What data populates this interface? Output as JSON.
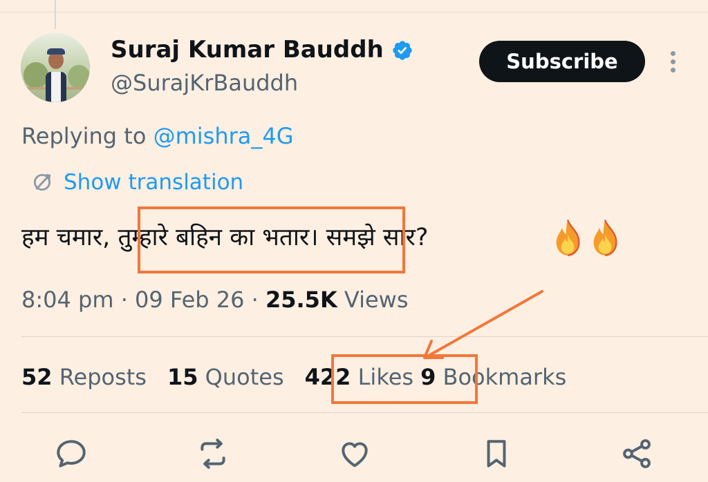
{
  "author": {
    "name": "Suraj Kumar Bauddh",
    "handle": "@SurajKrBauddh",
    "avatar_icon": "profile-photo",
    "verified_icon": "verified-badge-icon",
    "verified_color": "#1d9bf0"
  },
  "subscribe_label": "Subscribe",
  "reply": {
    "prefix": "Replying to ",
    "mention": "@mishra_4G"
  },
  "translation": {
    "icon": "translate-icon",
    "label": "Show translation"
  },
  "tweet": {
    "text_before": "हम चमार, ",
    "text_highlight": "तुम्हारे बहिन का भतार",
    "text_after": "। समझे सार?",
    "emojis": [
      "fire-emoji",
      "fire-emoji"
    ]
  },
  "meta": {
    "time": "8:04 pm",
    "sep1": " · ",
    "date": "09 Feb 26",
    "sep2": " · ",
    "views_count": "25.5K",
    "views_label": " Views"
  },
  "stats": {
    "reposts_count": "52",
    "reposts_label": " Reposts",
    "quotes_count": "15",
    "quotes_label": " Quotes",
    "likes_count": "422",
    "likes_label": " Likes",
    "bookmarks_count": "9",
    "bookmarks_label": " Bookmarks"
  },
  "actions": [
    "reply-icon",
    "repost-icon",
    "like-icon",
    "bookmark-icon",
    "share-icon"
  ],
  "colors": {
    "background": "#fdefe2",
    "annotation": "#f2773a",
    "link": "#1d9bf0",
    "secondary_text": "#536471",
    "primary_text": "#0f1419"
  }
}
